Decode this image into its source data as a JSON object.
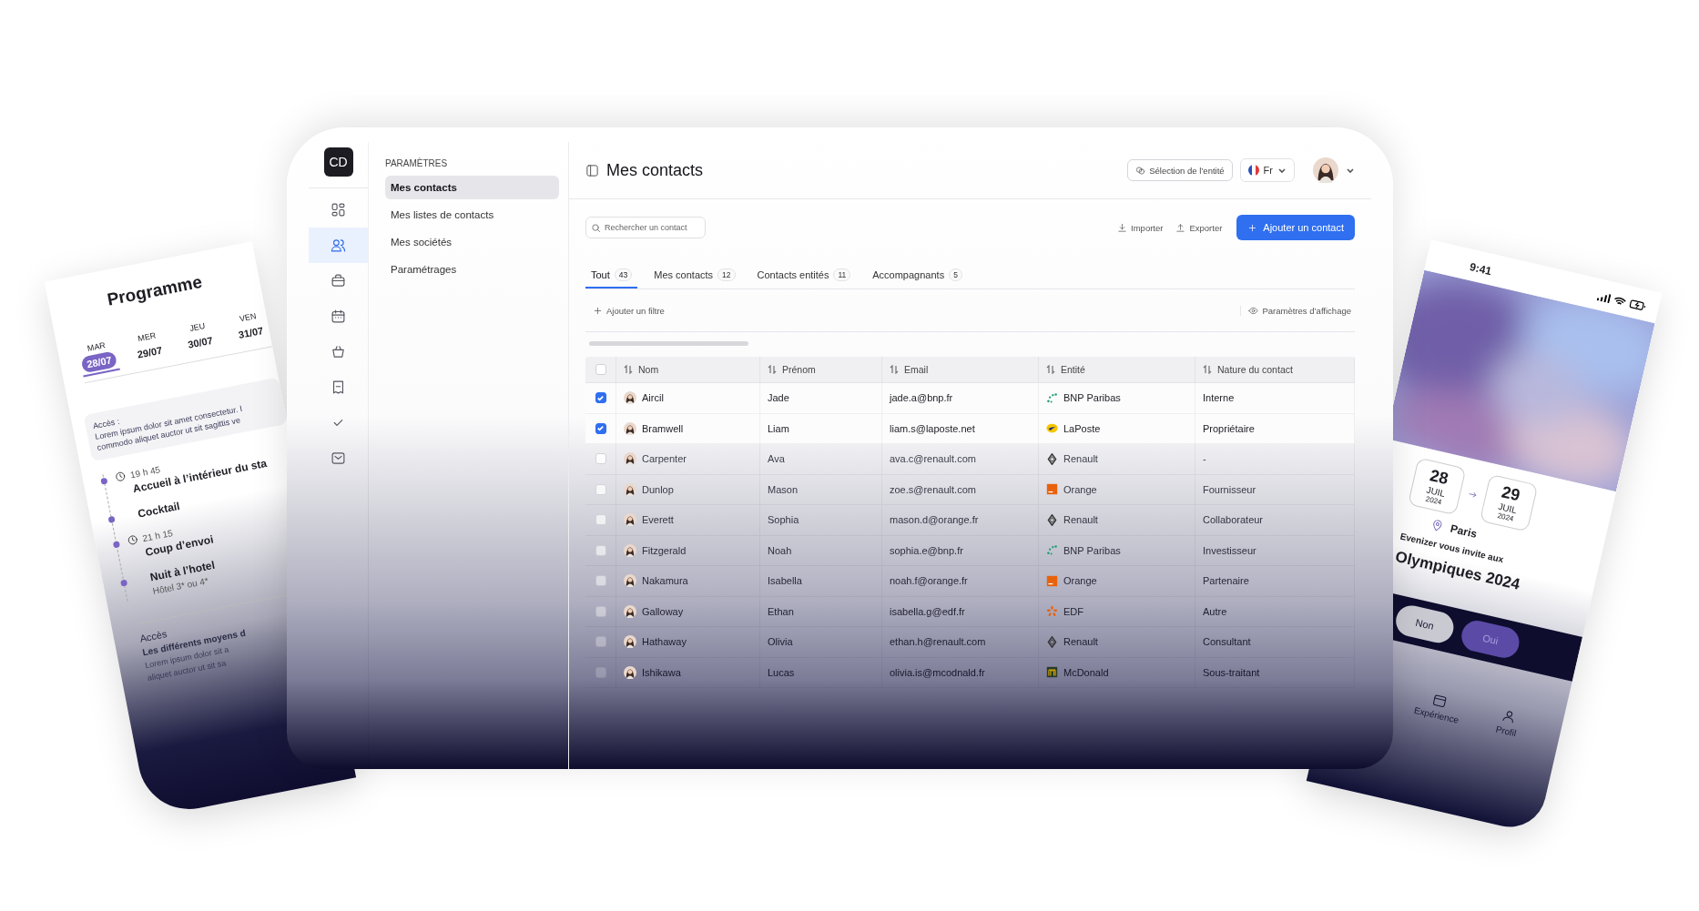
{
  "left_phone": {
    "title": "Programme",
    "days": [
      {
        "weekday": "MAR",
        "date": "28/07",
        "selected": true
      },
      {
        "weekday": "MER",
        "date": "29/07",
        "selected": false
      },
      {
        "weekday": "JEU",
        "date": "30/07",
        "selected": false
      },
      {
        "weekday": "VEN",
        "date": "31/07",
        "selected": false
      }
    ],
    "access_card": {
      "label": "Accès :",
      "lines": [
        "Lorem ipsum dolor sit amet consectetur. I",
        "commodo aliquet auctor ut sit sagittis ve"
      ]
    },
    "timeline": [
      {
        "time": "19 h 45",
        "title": "Accueil à l’intérieur du sta"
      },
      {
        "title": "Cocktail"
      },
      {
        "time": "21 h 15",
        "title": "Coup d’envoi"
      },
      {
        "title": "Nuit à l’hotel",
        "subtitle": "Hôtel 3* ou 4*"
      }
    ],
    "access_section": {
      "title": "Accès",
      "subtitle": "Les différents moyens d",
      "lines": [
        "Lorem ipsum dolor sit a",
        "aliquet auctor ut sit sa"
      ]
    }
  },
  "app": {
    "avatar_initials": "CD",
    "nav": [
      {
        "kind": "dashboard",
        "selected": false
      },
      {
        "kind": "contacts",
        "selected": true
      },
      {
        "kind": "briefcase",
        "selected": false
      },
      {
        "kind": "calendar",
        "selected": false
      },
      {
        "kind": "basket",
        "selected": false
      },
      {
        "kind": "ticket",
        "selected": false
      },
      {
        "kind": "check",
        "selected": false
      },
      {
        "kind": "mail",
        "selected": false
      }
    ],
    "sidebar": {
      "heading": "PARAMÈTRES",
      "items": [
        {
          "label": "Mes contacts",
          "selected": true
        },
        {
          "label": "Mes listes de contacts",
          "selected": false
        },
        {
          "label": "Mes sociétés",
          "selected": false
        },
        {
          "label": "Paramétrages",
          "selected": false
        }
      ]
    },
    "header": {
      "title": "Mes contacts",
      "entity_button": "Sélection de l’entité",
      "language": "Fr"
    },
    "toolbar": {
      "search_placeholder": "Rechercher un contact",
      "import": "Importer",
      "export": "Exporter",
      "add": "Ajouter un contact"
    },
    "tabs": [
      {
        "label": "Tout",
        "count": "43",
        "selected": true
      },
      {
        "label": "Mes contacts",
        "count": "12",
        "selected": false
      },
      {
        "label": "Contacts entités",
        "count": "11",
        "selected": false
      },
      {
        "label": "Accompagnants",
        "count": "5",
        "selected": false
      }
    ],
    "filters": {
      "add": "Ajouter un filtre",
      "display": "Paramètres d’affichage"
    },
    "table": {
      "columns": [
        "Nom",
        "Prénom",
        "Email",
        "Entité",
        "Nature du contact"
      ],
      "select_all_checked": false,
      "rows": [
        {
          "last": "Aircil",
          "first": "Jade",
          "email": "jade.a@bnp.fr",
          "entity": {
            "name": "BNP Paribas",
            "kind": "bnp"
          },
          "nature": "Interne",
          "checked": true
        },
        {
          "last": "Bramwell",
          "first": "Liam",
          "email": "liam.s@laposte.net",
          "entity": {
            "name": "LaPoste",
            "kind": "laposte"
          },
          "nature": "Propriétaire",
          "checked": true
        },
        {
          "last": "Carpenter",
          "first": "Ava",
          "email": "ava.c@renault.com",
          "entity": {
            "name": "Renault",
            "kind": "renault"
          },
          "nature": "-",
          "checked": false
        },
        {
          "last": "Dunlop",
          "first": "Mason",
          "email": "zoe.s@renault.com",
          "entity": {
            "name": "Orange",
            "kind": "orange"
          },
          "nature": "Fournisseur",
          "checked": false
        },
        {
          "last": "Everett",
          "first": "Sophia",
          "email": "mason.d@orange.fr",
          "entity": {
            "name": "Renault",
            "kind": "renault"
          },
          "nature": "Collaborateur",
          "checked": false
        },
        {
          "last": "Fitzgerald",
          "first": "Noah",
          "email": "sophia.e@bnp.fr",
          "entity": {
            "name": "BNP Paribas",
            "kind": "bnp"
          },
          "nature": "Investisseur",
          "checked": false
        },
        {
          "last": "Nakamura",
          "first": "Isabella",
          "email": "noah.f@orange.fr",
          "entity": {
            "name": "Orange",
            "kind": "orange"
          },
          "nature": "Partenaire",
          "checked": false
        },
        {
          "last": "Galloway",
          "first": "Ethan",
          "email": "isabella.g@edf.fr",
          "entity": {
            "name": "EDF",
            "kind": "edf"
          },
          "nature": "Autre",
          "checked": false
        },
        {
          "last": "Hathaway",
          "first": "Olivia",
          "email": "ethan.h@renault.com",
          "entity": {
            "name": "Renault",
            "kind": "renault"
          },
          "nature": "Consultant",
          "checked": false
        },
        {
          "last": "Ishikawa",
          "first": "Lucas",
          "email": "olivia.is@mcodnald.fr",
          "entity": {
            "name": "McDonald",
            "kind": "mcdonald"
          },
          "nature": "Sous-traitant",
          "checked": false
        }
      ]
    }
  },
  "right_phone": {
    "time": "9:41",
    "dates": [
      {
        "day": "28",
        "month": "JUIL",
        "year": "2024"
      },
      {
        "day": "29",
        "month": "JUIL",
        "year": "2024"
      }
    ],
    "location": "Paris",
    "invite": "Evenizer vous invite aux",
    "event": "Olympiques 2024",
    "buttons": [
      {
        "label": "Non",
        "selected": false
      },
      {
        "label": "Oui",
        "selected": true
      }
    ],
    "nav": [
      {
        "label": "Expérience",
        "kind": "calendar"
      },
      {
        "label": "Profil",
        "kind": "profile"
      }
    ]
  }
}
